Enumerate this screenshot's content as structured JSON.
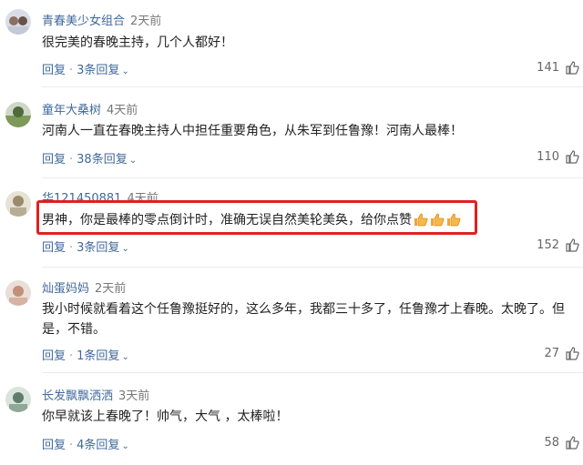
{
  "comments": [
    {
      "user": "青春美少女组合",
      "time": "2天前",
      "text": "很完美的春晚主持，几个人都好！",
      "reply_label": "回复",
      "replies_label": "3条回复",
      "likes": "141"
    },
    {
      "user": "童年大桑树",
      "time": "4天前",
      "text": "河南人一直在春晚主持人中担任重要角色，从朱军到任鲁豫！河南人最棒！",
      "reply_label": "回复",
      "replies_label": "38条回复",
      "likes": "110"
    },
    {
      "user": "华121450881",
      "time": "4天前",
      "text": "男神，你是最棒的零点倒计时，准确无误自然美轮美奂，给你点赞",
      "reply_label": "回复",
      "replies_label": "3条回复",
      "likes": "152"
    },
    {
      "user": "灿蛋妈妈",
      "time": "2天前",
      "text": "我小时候就看着这个任鲁豫挺好的，这么多年，我都三十多了，任鲁豫才上春晚。太晚了。但是，不错。",
      "reply_label": "回复",
      "replies_label": "1条回复",
      "likes": "27"
    },
    {
      "user": "长发飘飘洒洒",
      "time": "3天前",
      "text": "你早就该上春晚了！帅气，大气 ，太棒啦！",
      "reply_label": "回复",
      "replies_label": "4条回复",
      "likes": "58"
    }
  ],
  "colors": {
    "link": "#40699b",
    "highlight_border": "#e02020"
  }
}
